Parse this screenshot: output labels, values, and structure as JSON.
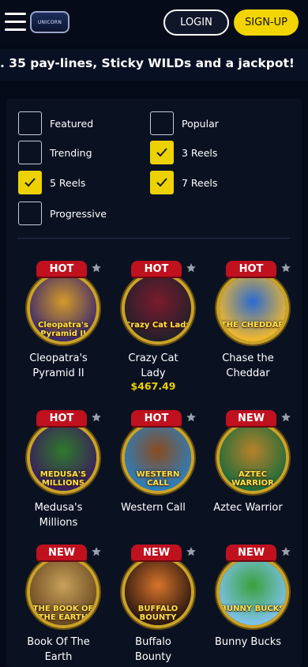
{
  "header": {
    "logo_text": "UNICORN",
    "login_label": "LOGIN",
    "signup_label": "SIGN-UP"
  },
  "marquee": {
    "text": ". 35 pay-lines, Sticky WILDs and a jackpot!"
  },
  "filters": [
    {
      "label": "Featured",
      "checked": false
    },
    {
      "label": "Popular",
      "checked": false
    },
    {
      "label": "Trending",
      "checked": false
    },
    {
      "label": "3 Reels",
      "checked": true
    },
    {
      "label": "5 Reels",
      "checked": true
    },
    {
      "label": "7 Reels",
      "checked": true
    },
    {
      "label": "Progressive",
      "checked": false
    }
  ],
  "games": [
    {
      "name_line1": "Cleopatra's",
      "name_line2": "Pyramid II",
      "badge": "HOT",
      "jackpot": "",
      "art": "Cleopatra's Pyramid II",
      "color_a": "#3d2a6b",
      "color_b": "#d49a2a"
    },
    {
      "name_line1": "Crazy Cat",
      "name_line2": "Lady",
      "badge": "HOT",
      "jackpot": "$467.49",
      "art": "Crazy Cat Lady",
      "color_a": "#23202a",
      "color_b": "#7a1b2d"
    },
    {
      "name_line1": "Chase the",
      "name_line2": "Cheddar",
      "badge": "HOT",
      "jackpot": "",
      "art": "THE CHEDDAR",
      "color_a": "#f4b92a",
      "color_b": "#2a6ad2"
    },
    {
      "name_line1": "Medusa's",
      "name_line2": "Millions",
      "badge": "HOT",
      "jackpot": "",
      "art": "MEDUSA'S MILLIONS",
      "color_a": "#3b1d5c",
      "color_b": "#2e7a2c"
    },
    {
      "name_line1": "Western Call",
      "name_line2": "",
      "badge": "HOT",
      "jackpot": "",
      "art": "WESTERN CALL",
      "color_a": "#2b7fbf",
      "color_b": "#8a4b1f"
    },
    {
      "name_line1": "Aztec Warrior",
      "name_line2": "",
      "badge": "NEW",
      "jackpot": "",
      "art": "AZTEC WARRIOR",
      "color_a": "#1f6b3a",
      "color_b": "#b7822a"
    },
    {
      "name_line1": "Book Of The",
      "name_line2": "Earth",
      "badge": "NEW",
      "jackpot": "",
      "art": "THE BOOK OF THE EARTH",
      "color_a": "#6b4a22",
      "color_b": "#c8a15a"
    },
    {
      "name_line1": "Buffalo",
      "name_line2": "Bounty",
      "badge": "NEW",
      "jackpot": "",
      "art": "BUFFALO BOUNTY",
      "color_a": "#2a1710",
      "color_b": "#d8742a"
    },
    {
      "name_line1": "Bunny Bucks",
      "name_line2": "",
      "badge": "NEW",
      "jackpot": "",
      "art": "BUNNY BUCKS",
      "color_a": "#7ec3ee",
      "color_b": "#3aa03a"
    }
  ],
  "colors": {
    "accent": "#f2d500",
    "badge": "#c0111f",
    "background": "#050a18"
  }
}
